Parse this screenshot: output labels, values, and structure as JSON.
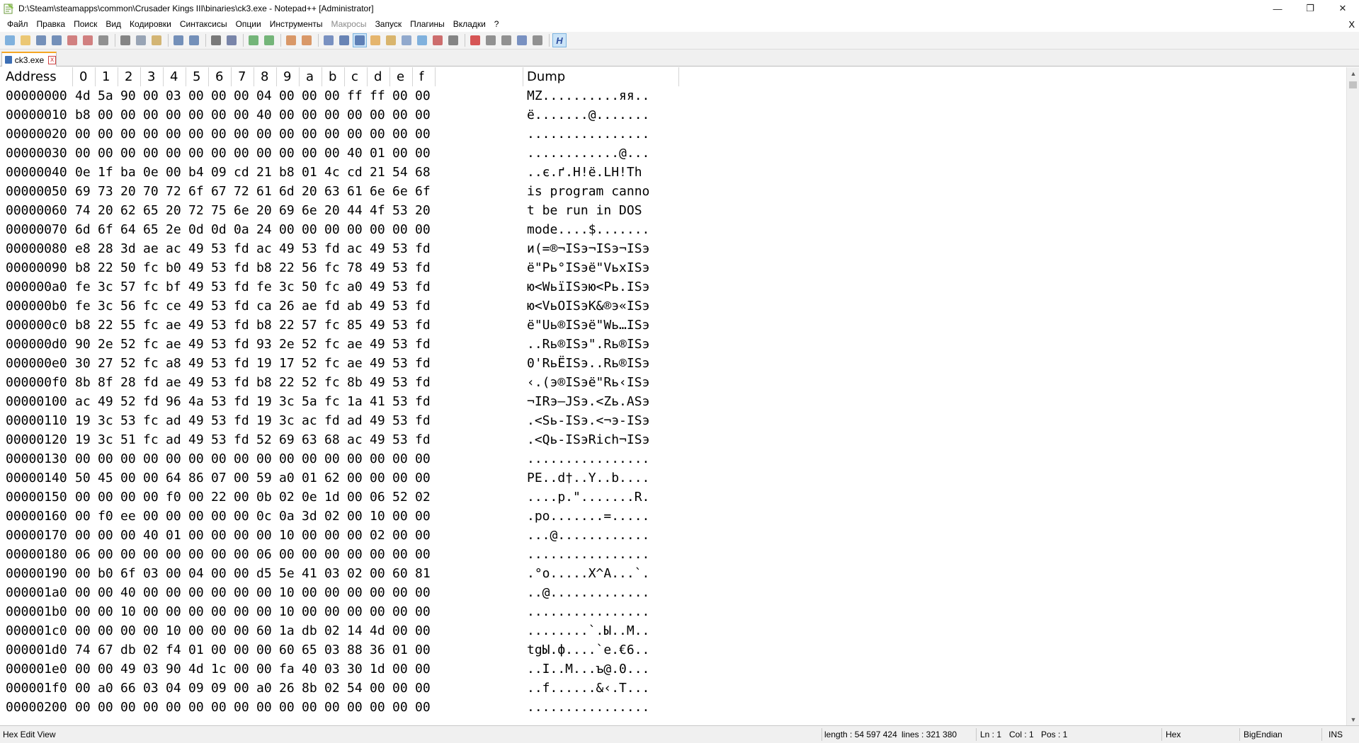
{
  "window": {
    "title": "D:\\Steam\\steamapps\\common\\Crusader Kings III\\binaries\\ck3.exe - Notepad++ [Administrator]",
    "minimize_glyph": "—",
    "maximize_glyph": "❐",
    "close_glyph": "✕"
  },
  "menu": {
    "items": [
      {
        "label": "Файл",
        "enabled": true
      },
      {
        "label": "Правка",
        "enabled": true
      },
      {
        "label": "Поиск",
        "enabled": true
      },
      {
        "label": "Вид",
        "enabled": true
      },
      {
        "label": "Кодировки",
        "enabled": true
      },
      {
        "label": "Синтаксисы",
        "enabled": true
      },
      {
        "label": "Опции",
        "enabled": true
      },
      {
        "label": "Инструменты",
        "enabled": true
      },
      {
        "label": "Макросы",
        "enabled": false
      },
      {
        "label": "Запуск",
        "enabled": true
      },
      {
        "label": "Плагины",
        "enabled": true
      },
      {
        "label": "Вкладки",
        "enabled": true
      },
      {
        "label": "?",
        "enabled": true
      }
    ],
    "close_glyph": "X"
  },
  "toolbar": {
    "groups": [
      [
        {
          "icon": "new-file-icon",
          "color": "#5a9bd5"
        },
        {
          "icon": "open-file-icon",
          "color": "#e8b84a"
        },
        {
          "icon": "save-icon",
          "color": "#4a6fa5"
        },
        {
          "icon": "save-all-icon",
          "color": "#4a6fa5"
        },
        {
          "icon": "close-icon",
          "color": "#c55a5a"
        },
        {
          "icon": "close-all-icon",
          "color": "#c55a5a"
        },
        {
          "icon": "print-icon",
          "color": "#707070"
        }
      ],
      [
        {
          "icon": "cut-icon",
          "color": "#606060"
        },
        {
          "icon": "copy-icon",
          "color": "#7a8aa0"
        },
        {
          "icon": "paste-icon",
          "color": "#c8a04a"
        }
      ],
      [
        {
          "icon": "undo-icon",
          "color": "#4a6fa5"
        },
        {
          "icon": "redo-icon",
          "color": "#4a6fa5"
        }
      ],
      [
        {
          "icon": "find-icon",
          "color": "#505050"
        },
        {
          "icon": "replace-icon",
          "color": "#506090"
        }
      ],
      [
        {
          "icon": "zoom-in-icon",
          "color": "#4aa050"
        },
        {
          "icon": "zoom-out-icon",
          "color": "#4aa050"
        }
      ],
      [
        {
          "icon": "sync-vertical-icon",
          "color": "#d07a3a"
        },
        {
          "icon": "sync-horizontal-icon",
          "color": "#d07a3a"
        }
      ],
      [
        {
          "icon": "word-wrap-icon",
          "color": "#5070b0"
        },
        {
          "icon": "show-all-chars-icon",
          "color": "#3a5fa0"
        },
        {
          "icon": "indent-guide-icon",
          "color": "#3a5fa0",
          "active": true
        },
        {
          "icon": "udl-icon",
          "color": "#e0a040"
        },
        {
          "icon": "doc-map-icon",
          "color": "#d0a040"
        },
        {
          "icon": "function-list-icon",
          "color": "#7090c0"
        },
        {
          "icon": "folder-workspace-icon",
          "color": "#5a9bd5"
        },
        {
          "icon": "monitoring-icon",
          "color": "#c04040"
        },
        {
          "icon": "eye-icon",
          "color": "#606060"
        }
      ],
      [
        {
          "icon": "record-macro-icon",
          "color": "#cc2020"
        },
        {
          "icon": "stop-macro-icon",
          "color": "#707070"
        },
        {
          "icon": "play-macro-icon",
          "color": "#707070"
        },
        {
          "icon": "play-multiple-icon",
          "color": "#5070b0"
        },
        {
          "icon": "save-macro-icon",
          "color": "#707070"
        }
      ],
      [
        {
          "icon": "hex-editor-icon",
          "color": "#3050a0",
          "active": true
        }
      ]
    ],
    "hex_glyph": "H"
  },
  "tab": {
    "label": "ck3.exe",
    "close_glyph": "x"
  },
  "hex": {
    "header": {
      "address": "Address",
      "columns": [
        "0",
        "1",
        "2",
        "3",
        "4",
        "5",
        "6",
        "7",
        "8",
        "9",
        "a",
        "b",
        "c",
        "d",
        "e",
        "f"
      ],
      "dump": "Dump"
    },
    "rows": [
      {
        "addr": "00000000",
        "bytes": [
          "4d",
          "5a",
          "90",
          "00",
          "03",
          "00",
          "00",
          "00",
          "04",
          "00",
          "00",
          "00",
          "ff",
          "ff",
          "00",
          "00"
        ],
        "dump": "MZ..........яя.."
      },
      {
        "addr": "00000010",
        "bytes": [
          "b8",
          "00",
          "00",
          "00",
          "00",
          "00",
          "00",
          "00",
          "40",
          "00",
          "00",
          "00",
          "00",
          "00",
          "00",
          "00"
        ],
        "dump": "ё.......@......."
      },
      {
        "addr": "00000020",
        "bytes": [
          "00",
          "00",
          "00",
          "00",
          "00",
          "00",
          "00",
          "00",
          "00",
          "00",
          "00",
          "00",
          "00",
          "00",
          "00",
          "00"
        ],
        "dump": "................"
      },
      {
        "addr": "00000030",
        "bytes": [
          "00",
          "00",
          "00",
          "00",
          "00",
          "00",
          "00",
          "00",
          "00",
          "00",
          "00",
          "00",
          "40",
          "01",
          "00",
          "00"
        ],
        "dump": "............@..."
      },
      {
        "addr": "00000040",
        "bytes": [
          "0e",
          "1f",
          "ba",
          "0e",
          "00",
          "b4",
          "09",
          "cd",
          "21",
          "b8",
          "01",
          "4c",
          "cd",
          "21",
          "54",
          "68"
        ],
        "dump": "..є.ґ.Н!ё.LН!Th"
      },
      {
        "addr": "00000050",
        "bytes": [
          "69",
          "73",
          "20",
          "70",
          "72",
          "6f",
          "67",
          "72",
          "61",
          "6d",
          "20",
          "63",
          "61",
          "6e",
          "6e",
          "6f"
        ],
        "dump": "is program canno"
      },
      {
        "addr": "00000060",
        "bytes": [
          "74",
          "20",
          "62",
          "65",
          "20",
          "72",
          "75",
          "6e",
          "20",
          "69",
          "6e",
          "20",
          "44",
          "4f",
          "53",
          "20"
        ],
        "dump": "t be run in DOS "
      },
      {
        "addr": "00000070",
        "bytes": [
          "6d",
          "6f",
          "64",
          "65",
          "2e",
          "0d",
          "0d",
          "0a",
          "24",
          "00",
          "00",
          "00",
          "00",
          "00",
          "00",
          "00"
        ],
        "dump": "mode....$......."
      },
      {
        "addr": "00000080",
        "bytes": [
          "e8",
          "28",
          "3d",
          "ae",
          "ac",
          "49",
          "53",
          "fd",
          "ac",
          "49",
          "53",
          "fd",
          "ac",
          "49",
          "53",
          "fd"
        ],
        "dump": "и(=®¬ISэ¬ISэ¬ISэ"
      },
      {
        "addr": "00000090",
        "bytes": [
          "b8",
          "22",
          "50",
          "fc",
          "b0",
          "49",
          "53",
          "fd",
          "b8",
          "22",
          "56",
          "fc",
          "78",
          "49",
          "53",
          "fd"
        ],
        "dump": "ё\"Pь°ISэё\"VьxISэ"
      },
      {
        "addr": "000000a0",
        "bytes": [
          "fe",
          "3c",
          "57",
          "fc",
          "bf",
          "49",
          "53",
          "fd",
          "fe",
          "3c",
          "50",
          "fc",
          "a0",
          "49",
          "53",
          "fd"
        ],
        "dump": "ю<WьїISэю<Pь.ISэ"
      },
      {
        "addr": "000000b0",
        "bytes": [
          "fe",
          "3c",
          "56",
          "fc",
          "ce",
          "49",
          "53",
          "fd",
          "ca",
          "26",
          "ae",
          "fd",
          "ab",
          "49",
          "53",
          "fd"
        ],
        "dump": "ю<VьОISэК&®э«ISэ"
      },
      {
        "addr": "000000c0",
        "bytes": [
          "b8",
          "22",
          "55",
          "fc",
          "ae",
          "49",
          "53",
          "fd",
          "b8",
          "22",
          "57",
          "fc",
          "85",
          "49",
          "53",
          "fd"
        ],
        "dump": "ё\"Uь®ISэё\"Wь…ISэ"
      },
      {
        "addr": "000000d0",
        "bytes": [
          "90",
          "2e",
          "52",
          "fc",
          "ae",
          "49",
          "53",
          "fd",
          "93",
          "2e",
          "52",
          "fc",
          "ae",
          "49",
          "53",
          "fd"
        ],
        "dump": "..Rь®ISэ\".Rь®ISэ"
      },
      {
        "addr": "000000e0",
        "bytes": [
          "30",
          "27",
          "52",
          "fc",
          "a8",
          "49",
          "53",
          "fd",
          "19",
          "17",
          "52",
          "fc",
          "ae",
          "49",
          "53",
          "fd"
        ],
        "dump": "0'RьЁISэ..Rь®ISэ"
      },
      {
        "addr": "000000f0",
        "bytes": [
          "8b",
          "8f",
          "28",
          "fd",
          "ae",
          "49",
          "53",
          "fd",
          "b8",
          "22",
          "52",
          "fc",
          "8b",
          "49",
          "53",
          "fd"
        ],
        "dump": "‹.(э®ISэё\"Rь‹ISэ"
      },
      {
        "addr": "00000100",
        "bytes": [
          "ac",
          "49",
          "52",
          "fd",
          "96",
          "4a",
          "53",
          "fd",
          "19",
          "3c",
          "5a",
          "fc",
          "1a",
          "41",
          "53",
          "fd"
        ],
        "dump": "¬IRэ–JSэ.<Zь.ASэ"
      },
      {
        "addr": "00000110",
        "bytes": [
          "19",
          "3c",
          "53",
          "fc",
          "ad",
          "49",
          "53",
          "fd",
          "19",
          "3c",
          "ac",
          "fd",
          "ad",
          "49",
          "53",
          "fd"
        ],
        "dump": ".<Sь-ISэ.<¬э-ISэ"
      },
      {
        "addr": "00000120",
        "bytes": [
          "19",
          "3c",
          "51",
          "fc",
          "ad",
          "49",
          "53",
          "fd",
          "52",
          "69",
          "63",
          "68",
          "ac",
          "49",
          "53",
          "fd"
        ],
        "dump": ".<Qь-ISэRich¬ISэ"
      },
      {
        "addr": "00000130",
        "bytes": [
          "00",
          "00",
          "00",
          "00",
          "00",
          "00",
          "00",
          "00",
          "00",
          "00",
          "00",
          "00",
          "00",
          "00",
          "00",
          "00"
        ],
        "dump": "................"
      },
      {
        "addr": "00000140",
        "bytes": [
          "50",
          "45",
          "00",
          "00",
          "64",
          "86",
          "07",
          "00",
          "59",
          "a0",
          "01",
          "62",
          "00",
          "00",
          "00",
          "00"
        ],
        "dump": "PE..d†..Y..b...."
      },
      {
        "addr": "00000150",
        "bytes": [
          "00",
          "00",
          "00",
          "00",
          "f0",
          "00",
          "22",
          "00",
          "0b",
          "02",
          "0e",
          "1d",
          "00",
          "06",
          "52",
          "02"
        ],
        "dump": "....р.\".......R."
      },
      {
        "addr": "00000160",
        "bytes": [
          "00",
          "f0",
          "ee",
          "00",
          "00",
          "00",
          "00",
          "00",
          "0c",
          "0a",
          "3d",
          "02",
          "00",
          "10",
          "00",
          "00"
        ],
        "dump": ".ро.......=....."
      },
      {
        "addr": "00000170",
        "bytes": [
          "00",
          "00",
          "00",
          "40",
          "01",
          "00",
          "00",
          "00",
          "00",
          "10",
          "00",
          "00",
          "00",
          "02",
          "00",
          "00"
        ],
        "dump": "...@............"
      },
      {
        "addr": "00000180",
        "bytes": [
          "06",
          "00",
          "00",
          "00",
          "00",
          "00",
          "00",
          "00",
          "06",
          "00",
          "00",
          "00",
          "00",
          "00",
          "00",
          "00"
        ],
        "dump": "................"
      },
      {
        "addr": "00000190",
        "bytes": [
          "00",
          "b0",
          "6f",
          "03",
          "00",
          "04",
          "00",
          "00",
          "d5",
          "5e",
          "41",
          "03",
          "02",
          "00",
          "60",
          "81"
        ],
        "dump": ".°o.....Х^A...`."
      },
      {
        "addr": "000001a0",
        "bytes": [
          "00",
          "00",
          "40",
          "00",
          "00",
          "00",
          "00",
          "00",
          "00",
          "10",
          "00",
          "00",
          "00",
          "00",
          "00",
          "00"
        ],
        "dump": "..@............."
      },
      {
        "addr": "000001b0",
        "bytes": [
          "00",
          "00",
          "10",
          "00",
          "00",
          "00",
          "00",
          "00",
          "00",
          "10",
          "00",
          "00",
          "00",
          "00",
          "00",
          "00"
        ],
        "dump": "................"
      },
      {
        "addr": "000001c0",
        "bytes": [
          "00",
          "00",
          "00",
          "00",
          "10",
          "00",
          "00",
          "00",
          "60",
          "1a",
          "db",
          "02",
          "14",
          "4d",
          "00",
          "00"
        ],
        "dump": "........`.Ы..M.."
      },
      {
        "addr": "000001d0",
        "bytes": [
          "74",
          "67",
          "db",
          "02",
          "f4",
          "01",
          "00",
          "00",
          "00",
          "60",
          "65",
          "03",
          "88",
          "36",
          "01",
          "00"
        ],
        "dump": "tgЫ.ф....`e.€6.."
      },
      {
        "addr": "000001e0",
        "bytes": [
          "00",
          "00",
          "49",
          "03",
          "90",
          "4d",
          "1c",
          "00",
          "00",
          "fa",
          "40",
          "03",
          "30",
          "1d",
          "00",
          "00"
        ],
        "dump": "..I..M...ъ@.0..."
      },
      {
        "addr": "000001f0",
        "bytes": [
          "00",
          "a0",
          "66",
          "03",
          "04",
          "09",
          "09",
          "00",
          "a0",
          "26",
          "8b",
          "02",
          "54",
          "00",
          "00",
          "00"
        ],
        "dump": "..f......&‹.T..."
      },
      {
        "addr": "00000200",
        "bytes": [
          "00",
          "00",
          "00",
          "00",
          "00",
          "00",
          "00",
          "00",
          "00",
          "00",
          "00",
          "00",
          "00",
          "00",
          "00",
          "00"
        ],
        "dump": "................"
      }
    ]
  },
  "scrollbar": {
    "up_glyph": "▲",
    "down_glyph": "▼"
  },
  "status": {
    "mode": "Hex Edit View",
    "length": "length : 54 597 424",
    "lines": "lines : 321 380",
    "ln": "Ln : 1",
    "col": "Col : 1",
    "pos": "Pos : 1",
    "format": "Hex",
    "endian": "BigEndian",
    "ins": "INS"
  }
}
